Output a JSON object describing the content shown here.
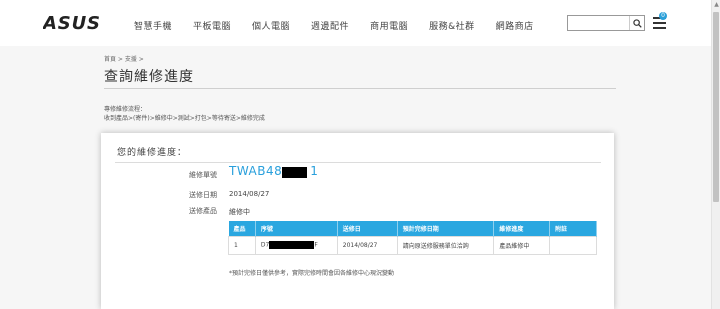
{
  "header": {
    "logo_text": "ASUS",
    "nav": [
      "智慧手機",
      "平板電腦",
      "個人電腦",
      "週邊配件",
      "商用電腦",
      "服務&社群",
      "網路商店"
    ],
    "search_placeholder": "",
    "cart_count": "0"
  },
  "breadcrumb": "首頁 > 支援 >",
  "page_title": "查詢維修進度",
  "process": {
    "label": "專修維修流程：",
    "steps": "收到產品>(寄件)>維修中>測試>打包>等待寄送>維修完成"
  },
  "card": {
    "title": "您的維修進度：",
    "serial_label": "維修單號",
    "serial_value_prefix": "TWAB48",
    "serial_value_suffix": "1",
    "date_label": "送修日期",
    "date_value": "2014/08/27",
    "product_label": "送修產品",
    "product_value": "維修中",
    "table": {
      "headers": [
        "產品",
        "序號",
        "送修日",
        "預計完修日期",
        "維修進度",
        "附註"
      ],
      "rows": [
        {
          "index": "1",
          "serial_prefix": "D7",
          "serial_suffix": "F",
          "date": "2014/08/27",
          "eta": "請向原送修服務單位洽詢",
          "status": "產品維修中",
          "note": ""
        }
      ]
    },
    "note": "*預計完修日僅供參考，實際完修時間會因各維修中心現況變動"
  },
  "colors": {
    "accent": "#2aa7e0",
    "link": "#2aa0dc"
  }
}
